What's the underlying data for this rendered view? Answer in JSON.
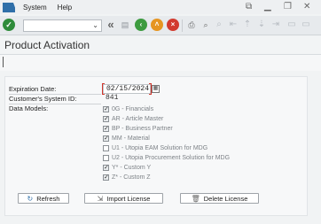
{
  "menubar": {
    "items": [
      "System",
      "Help"
    ],
    "controls": [
      "⧉",
      "▁",
      "❐",
      "✕"
    ]
  },
  "toolbar": {
    "command_field": "",
    "icons": [
      "enter-icon",
      "back-icon",
      "save-icon",
      "exit-icon",
      "cancel-icon",
      "print-icon",
      "find-icon"
    ]
  },
  "page": {
    "title": "Product Activation"
  },
  "form": {
    "expiration_label": "Expiration Date:",
    "expiration_value": "02/15/2024",
    "system_id_label": "Customer's System ID:",
    "system_id_value": "841",
    "data_models_label": "Data Models:",
    "models": [
      {
        "label": "0G - Financials",
        "checked": true
      },
      {
        "label": "AR - Article Master",
        "checked": true
      },
      {
        "label": "BP - Business Partner",
        "checked": true
      },
      {
        "label": "MM - Material",
        "checked": true
      },
      {
        "label": "U1 - Utopia EAM Solution for MDG",
        "checked": false
      },
      {
        "label": "U2 - Utopia Procurement Solution for MDG",
        "checked": false
      },
      {
        "label": "Y* - Custom Y",
        "checked": true
      },
      {
        "label": "Z* - Custom Z",
        "checked": true
      }
    ]
  },
  "buttons": {
    "refresh": "Refresh",
    "import": "Import License",
    "delete": "Delete License"
  }
}
